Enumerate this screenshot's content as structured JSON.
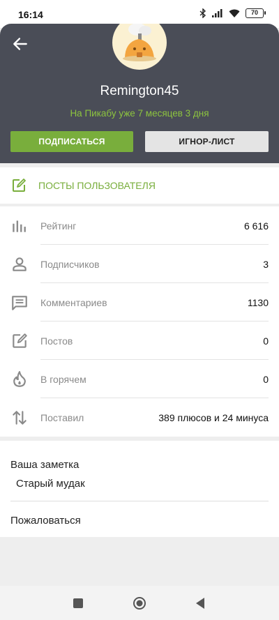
{
  "status_bar": {
    "time": "16:14",
    "battery": "70"
  },
  "profile": {
    "username": "Remington45",
    "member_since": "На Пикабу уже 7 месяцев 3 дня",
    "subscribe_label": "ПОДПИСАТЬСЯ",
    "ignore_label": "ИГНОР-ЛИСТ"
  },
  "posts_link": {
    "label": "ПОСТЫ ПОЛЬЗОВАТЕЛЯ"
  },
  "stats": [
    {
      "icon": "bar-chart-icon",
      "label": "Рейтинг",
      "value": "6 616"
    },
    {
      "icon": "person-icon",
      "label": "Подписчиков",
      "value": "3"
    },
    {
      "icon": "comment-icon",
      "label": "Комментариев",
      "value": "1130"
    },
    {
      "icon": "edit-icon",
      "label": "Постов",
      "value": "0"
    },
    {
      "icon": "fire-icon",
      "label": "В горячем",
      "value": "0"
    },
    {
      "icon": "swap-vertical-icon",
      "label": "Поставил",
      "value": "389 плюсов и 24 минуса"
    }
  ],
  "note": {
    "title": "Ваша заметка",
    "text": "Старый мудак"
  },
  "report": {
    "label": "Пожаловаться"
  },
  "colors": {
    "accent_green": "#79ae3c",
    "header_bg": "#4a4d57",
    "since_green": "#8dc43f"
  }
}
